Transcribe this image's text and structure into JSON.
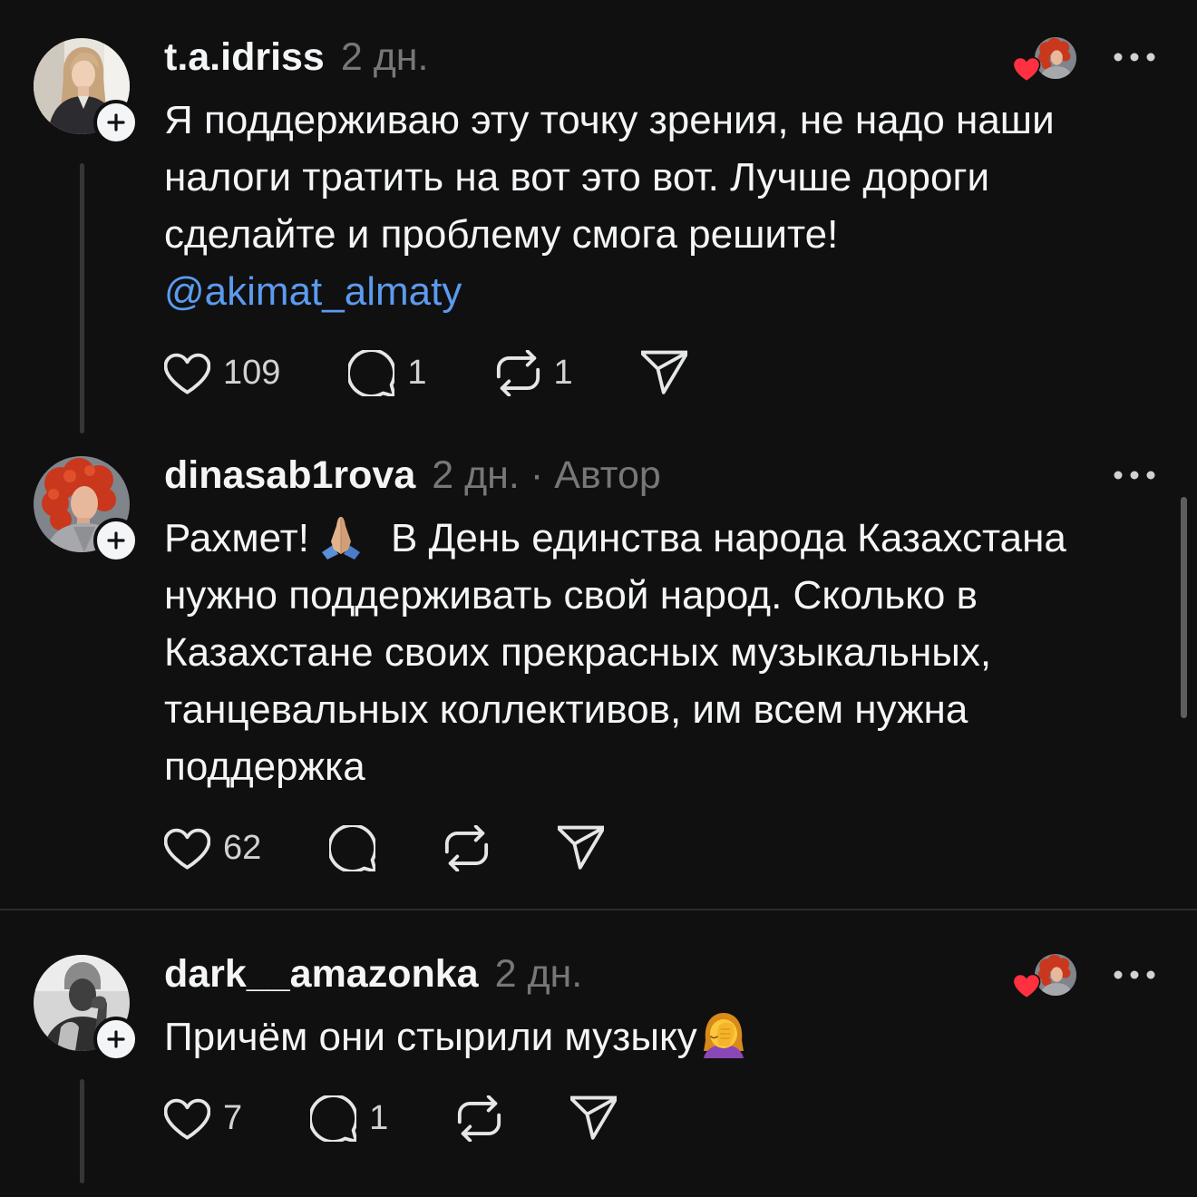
{
  "colors": {
    "background": "#101010",
    "text": "#f3f5f7",
    "secondary_text": "#777777",
    "count_text": "#d0d2d4",
    "icon": "#e4e6e8",
    "mention": "#5b9bef",
    "like_heart": "#ff3040",
    "divider": "#2d2d2d",
    "thread_line": "#363636"
  },
  "icons": {
    "like": "heart-icon",
    "reply": "comment-icon",
    "repost": "repost-icon",
    "share": "share-icon",
    "more": "more-icon",
    "follow": "plus-icon",
    "liked_by_author": "heart-icon"
  },
  "comments": [
    {
      "username": "t.a.idriss",
      "time": "2 дн.",
      "liked_by_author": true,
      "body_lines": [
        "Я поддерживаю эту точку зрения, не надо наши",
        "налоги тратить на вот это вот. Лучше дороги",
        "сделайте и проблему смога решите!"
      ],
      "mention": "@akimat_almaty",
      "likes": "109",
      "replies": "1",
      "reposts": "1"
    },
    {
      "username": "dinasab1rova",
      "time": "2 дн.",
      "separator": "·",
      "author_label": "Автор",
      "liked_by_author": false,
      "first_line": {
        "before": "Рахмет!",
        "emoji": "praying-hands-emoji-icon",
        "after": "В День единства народа Казахстана"
      },
      "body_lines": [
        "нужно поддерживать свой народ. Сколько в",
        "Казахстане своих прекрасных музыкальных,",
        "танцевальных коллективов, им всем нужна",
        "поддержка"
      ],
      "likes": "62"
    },
    {
      "username": "dark__amazonka",
      "time": "2 дн.",
      "liked_by_author": true,
      "body_text": "Причём они стырили музыку",
      "body_emoji": "woman-facepalming-emoji-icon",
      "likes": "7",
      "replies": "1"
    }
  ]
}
